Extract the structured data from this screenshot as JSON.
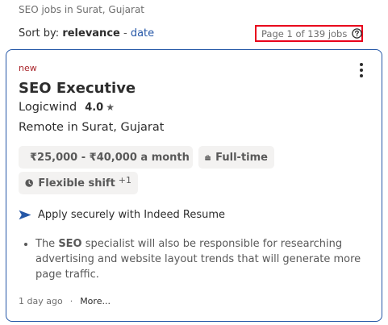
{
  "breadcrumb": "SEO jobs in Surat, Gujarat",
  "sort": {
    "prefix": "Sort by:",
    "active": "relevance",
    "separator": "-",
    "alternate": "date"
  },
  "page_count": "Page 1 of 139 jobs",
  "job": {
    "badge": "new",
    "title": "SEO Executive",
    "company": "Logicwind",
    "rating": "4.0",
    "star": "★",
    "location": "Remote in Surat, Gujarat",
    "salary": "₹25,000 - ₹40,000 a month",
    "job_type": "Full-time",
    "shift": "Flexible shift",
    "shift_more": "+1",
    "apply_text": "Apply securely with Indeed Resume",
    "snippet_pre": "The ",
    "snippet_bold": "SEO",
    "snippet_post": " specialist will also be responsible for researching advertising and website layout trends that will generate more page traffic.",
    "posted": "1 day ago",
    "footer_sep": "·",
    "more": "More..."
  },
  "icons": {
    "question": "question-circle-icon",
    "kebab": "more-options-icon",
    "salary": "money-icon",
    "type": "briefcase-icon",
    "shift": "clock-icon",
    "apply": "send-arrow-icon"
  },
  "colors": {
    "accent": "#2557a7",
    "highlight_border": "#e8001c",
    "new_badge": "#a9252b",
    "chip_bg": "#f3f2f1"
  }
}
